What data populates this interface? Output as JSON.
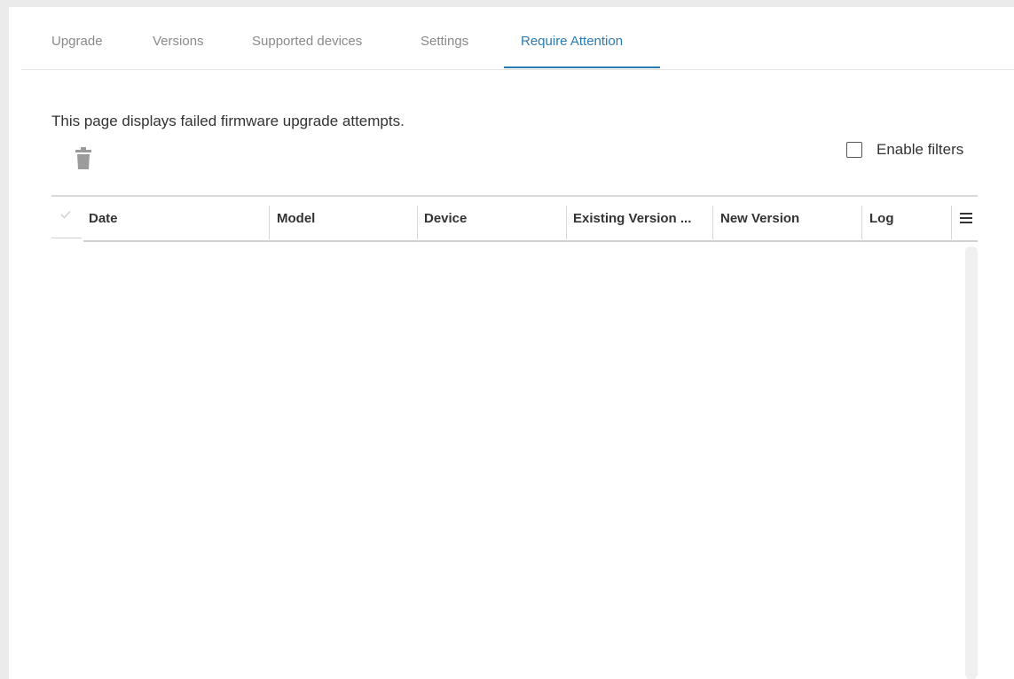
{
  "tabs": [
    {
      "label": "Upgrade",
      "active": false
    },
    {
      "label": "Versions",
      "active": false
    },
    {
      "label": "Supported devices",
      "active": false
    },
    {
      "label": "Settings",
      "active": false
    },
    {
      "label": "Require Attention",
      "active": true
    }
  ],
  "page": {
    "description": "This page displays failed firmware upgrade attempts.",
    "delete_icon": "trash-icon",
    "filters_label": "Enable filters",
    "filters_enabled": false
  },
  "grid": {
    "columns": [
      {
        "label": "Date"
      },
      {
        "label": "Model"
      },
      {
        "label": "Device"
      },
      {
        "label": "Existing Version ..."
      },
      {
        "label": "New Version"
      },
      {
        "label": "Log"
      }
    ],
    "rows": [],
    "menu_icon": "hamburger-menu-icon",
    "select_icon": "checkmark-icon"
  },
  "colors": {
    "accent": "#2b7bb4",
    "tab_inactive": "#8a8a8a",
    "text": "#333333"
  }
}
